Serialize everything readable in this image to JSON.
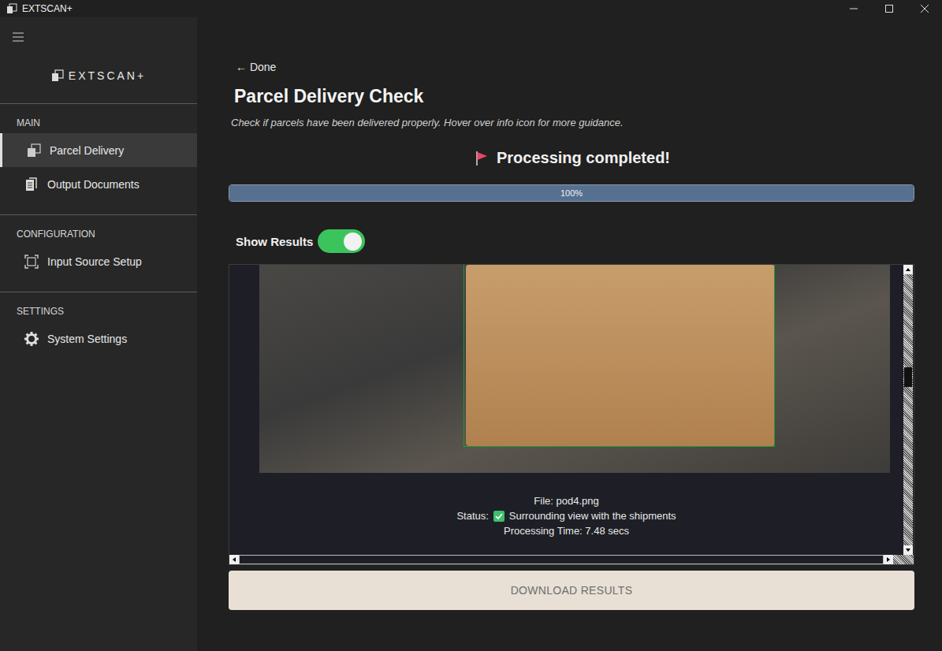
{
  "window": {
    "title": "EXTSCAN+"
  },
  "sidebar": {
    "logo": "EXTSCAN+",
    "sections": [
      {
        "title": "MAIN",
        "items": [
          {
            "label": "Parcel Delivery",
            "selected": true
          },
          {
            "label": "Output Documents",
            "selected": false
          }
        ]
      },
      {
        "title": "CONFIGURATION",
        "items": [
          {
            "label": "Input Source Setup",
            "selected": false
          }
        ]
      },
      {
        "title": "SETTINGS",
        "items": [
          {
            "label": "System Settings",
            "selected": false
          }
        ]
      }
    ]
  },
  "page": {
    "back": "← Done",
    "title": "Parcel Delivery Check",
    "subtitle": "Check if parcels have been delivered properly. Hover over info icon for more guidance.",
    "status": "Processing completed!",
    "progress": {
      "level": 1,
      "label": "100%"
    },
    "toggle": {
      "label": "Show Results",
      "on": true
    },
    "result": {
      "file": "File: pod4.png",
      "status_label": "Status:",
      "status_checked": true,
      "status_text": "Surrounding view with the shipments",
      "time": "Processing Time: 7.48 secs"
    },
    "download": {
      "label": "DOWNLOAD RESULTS"
    }
  }
}
